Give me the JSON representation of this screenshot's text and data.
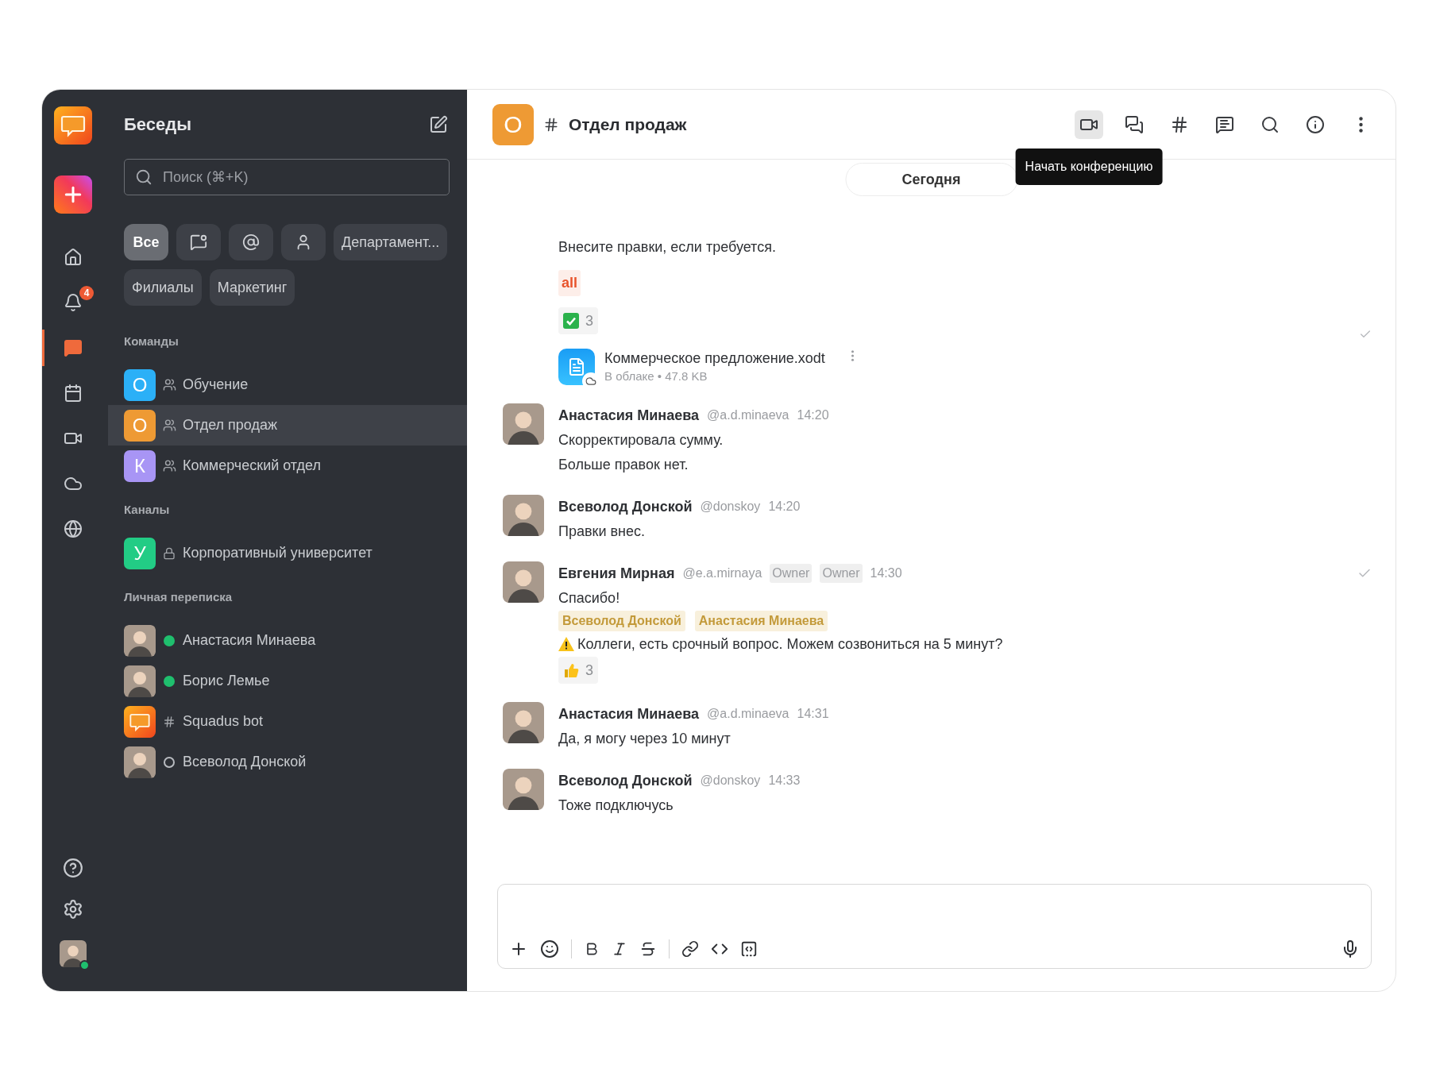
{
  "rail": {
    "items": [
      {
        "active": false
      },
      {
        "active": false,
        "badge": "4"
      },
      {
        "active": true
      },
      {
        "active": false
      },
      {
        "active": false
      },
      {
        "active": false
      },
      {
        "active": false
      }
    ],
    "user_online": true
  },
  "sidebar": {
    "title": "Беседы",
    "search": {
      "placeholder": "Поиск (⌘+K)"
    },
    "filters": [
      {
        "kind": "text",
        "label": "Все",
        "selected": true
      },
      {
        "kind": "icon",
        "selected": false
      },
      {
        "kind": "icon",
        "selected": false
      },
      {
        "kind": "icon",
        "selected": false
      },
      {
        "kind": "text",
        "label": "Департамент...",
        "selected": false
      },
      {
        "kind": "text",
        "label": "Филиалы",
        "selected": false
      },
      {
        "kind": "text",
        "label": "Маркетинг",
        "selected": false
      }
    ],
    "sections": [
      {
        "title": "Команды",
        "items": [
          {
            "avatar": {
              "kind": "letter",
              "letter": "О",
              "color": "#2bb0f7"
            },
            "marker": {
              "kind": "group"
            },
            "name": "Обучение",
            "selected": false
          },
          {
            "avatar": {
              "kind": "letter",
              "letter": "О",
              "color": "#ee9a34"
            },
            "marker": {
              "kind": "group"
            },
            "name": "Отдел продаж",
            "selected": true
          },
          {
            "avatar": {
              "kind": "letter",
              "letter": "К",
              "color": "#a895f5"
            },
            "marker": {
              "kind": "group"
            },
            "name": "Коммерческий отдел",
            "selected": false
          }
        ]
      },
      {
        "title": "Каналы",
        "items": [
          {
            "avatar": {
              "kind": "letter",
              "letter": "У",
              "color": "#22cc85"
            },
            "marker": {
              "kind": "lock"
            },
            "name": "Корпоративный университет",
            "selected": false
          }
        ]
      },
      {
        "title": "Личная переписка",
        "items": [
          {
            "avatar": {
              "kind": "person"
            },
            "marker": {
              "kind": "status",
              "online": true
            },
            "name": "Анастасия Минаева",
            "selected": false
          },
          {
            "avatar": {
              "kind": "person"
            },
            "marker": {
              "kind": "status",
              "online": true
            },
            "name": "Борис Лемье",
            "selected": false
          },
          {
            "avatar": {
              "kind": "bot"
            },
            "marker": {
              "kind": "hash"
            },
            "name": "Squadus bot",
            "selected": false
          },
          {
            "avatar": {
              "kind": "person"
            },
            "marker": {
              "kind": "status",
              "online": false
            },
            "name": "Всеволод Донской",
            "selected": false
          }
        ]
      }
    ]
  },
  "header": {
    "avatar_letter": "О",
    "title": "Отдел продаж",
    "actions": [
      {
        "active": true
      },
      {
        "active": false
      },
      {
        "active": false
      },
      {
        "active": false
      },
      {
        "active": false
      },
      {
        "active": false
      },
      {
        "active": false
      }
    ],
    "tooltip": "Начать конференцию"
  },
  "date_divider": "Сегодня",
  "posts": [
    {
      "kind": "continuation",
      "blocks": [
        {
          "kind": "text",
          "text": "Внесите правки, если требуется."
        },
        {
          "kind": "tag",
          "text": "all"
        },
        {
          "kind": "reaction",
          "emoji": {
            "kind": "check"
          },
          "count": "3"
        },
        {
          "kind": "file",
          "name": "Коммерческое предложение.xodt",
          "meta": "В облаке • 47.8 KB",
          "read": true
        }
      ]
    },
    {
      "kind": "message",
      "author": "Анастасия Минаева",
      "handle": "@a.d.minaeva",
      "time": "14:20",
      "read": false,
      "blocks": [
        {
          "kind": "text",
          "text": "Скорректировала сумму."
        },
        {
          "kind": "text",
          "text": "Больше правок нет."
        }
      ]
    },
    {
      "kind": "message",
      "author": "Всеволод Донской",
      "handle": "@donskoy",
      "time": "14:20",
      "read": false,
      "blocks": [
        {
          "kind": "text",
          "text": "Правки внес."
        }
      ]
    },
    {
      "kind": "message",
      "author": "Евгения Мирная",
      "handle": "@e.a.mirnaya",
      "roles": [
        "Owner",
        "Owner"
      ],
      "time": "14:30",
      "read": true,
      "blocks": [
        {
          "kind": "text",
          "text": "Спасибо!"
        },
        {
          "kind": "mentions",
          "names": [
            "Всеволод Донской",
            "Анастасия Минаева"
          ]
        },
        {
          "kind": "warning",
          "text": "Коллеги, есть срочный вопрос. Можем созвониться на 5 минут?"
        },
        {
          "kind": "reaction",
          "emoji": {
            "kind": "thumbs"
          },
          "count": "3"
        }
      ]
    },
    {
      "kind": "message",
      "author": "Анастасия Минаева",
      "handle": "@a.d.minaeva",
      "time": "14:31",
      "read": false,
      "blocks": [
        {
          "kind": "text",
          "text": "Да, я могу через 10 минут"
        }
      ]
    },
    {
      "kind": "message",
      "author": "Всеволод Донской",
      "handle": "@donskoy",
      "time": "14:33",
      "read": false,
      "blocks": [
        {
          "kind": "text",
          "text": "Тоже подключусь"
        }
      ]
    }
  ]
}
